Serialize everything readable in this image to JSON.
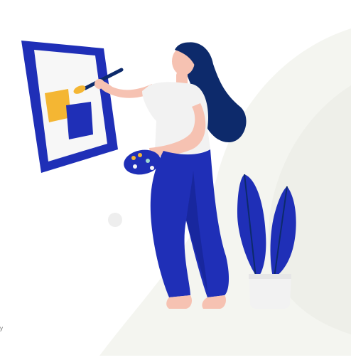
{
  "illustration": {
    "subject": "woman-painting-canvas",
    "colors": {
      "brand_blue": "#1f2fb7",
      "deep_blue": "#0d2a6b",
      "accent_yellow": "#f4b633",
      "skin": "#f6c2b2",
      "shirt": "#f2f2f2",
      "backdrop": "#f4f5f0"
    }
  },
  "edge_text": "y"
}
